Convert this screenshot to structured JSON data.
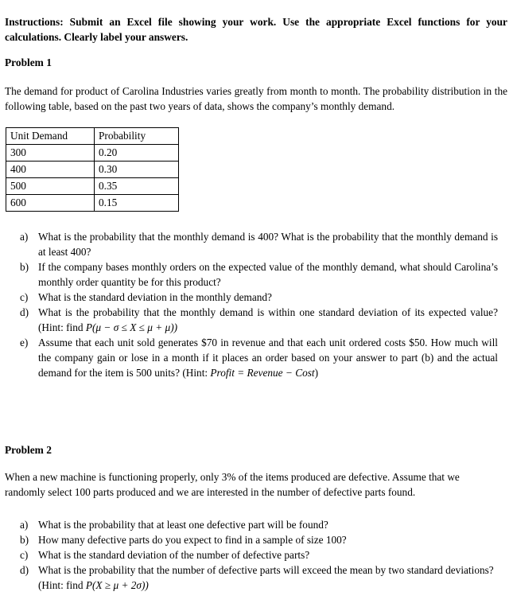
{
  "instructions": {
    "text": "Instructions: Submit an Excel file showing your work. Use the appropriate Excel functions for your calculations. Clearly label your answers."
  },
  "problem1": {
    "heading": "Problem 1",
    "intro": "The demand for product of Carolina Industries varies greatly from month to month. The probability distribution in the following table, based on the past two years of data, shows the company’s monthly demand.",
    "table": {
      "headers": [
        "Unit Demand",
        "Probability"
      ],
      "rows": [
        [
          "300",
          "0.20"
        ],
        [
          "400",
          "0.30"
        ],
        [
          "500",
          "0.35"
        ],
        [
          "600",
          "0.15"
        ]
      ]
    },
    "questions": [
      {
        "marker": "a)",
        "text": "What is the probability that the monthly demand is 400? What is the probability that the monthly demand is at least 400?"
      },
      {
        "marker": "b)",
        "text": "If the company bases monthly orders on the expected value of the monthly demand, what should Carolina’s monthly order quantity be for this product?"
      },
      {
        "marker": "c)",
        "text": "What is the standard deviation in the monthly demand?"
      },
      {
        "marker": "d)",
        "text_before": "What is the probability that the monthly demand is within one standard deviation of its expected value? (Hint: find ",
        "formula": "P(μ − σ ≤ X ≤ μ + μ))",
        "text_after": ""
      },
      {
        "marker": "e)",
        "text_before": "Assume that each unit sold generates $70 in revenue and that each unit ordered costs $50. How much will the company gain or lose in a month if it places an order based on your answer to part (b) and the actual demand for the item is 500 units? (Hint: ",
        "formula": "Profit = Revenue − Cost",
        "text_after": ")"
      }
    ]
  },
  "problem2": {
    "heading": "Problem 2",
    "intro": "When a new machine is functioning properly, only 3% of the items produced are defective. Assume that we randomly select 100 parts produced and we are interested in the number of defective parts found.",
    "questions": [
      {
        "marker": "a)",
        "text": "What is the probability that at least one defective part will be found?"
      },
      {
        "marker": "b)",
        "text": "How many defective parts do you expect to find in a sample of size 100?"
      },
      {
        "marker": "c)",
        "text": "What is the standard deviation of the number of defective parts?"
      },
      {
        "marker": "d)",
        "text_before": "What is the probability that the number of defective parts will exceed the mean by two standard deviations? (Hint: find ",
        "formula": "P(X ≥ μ + 2σ))",
        "text_after": ""
      }
    ]
  }
}
